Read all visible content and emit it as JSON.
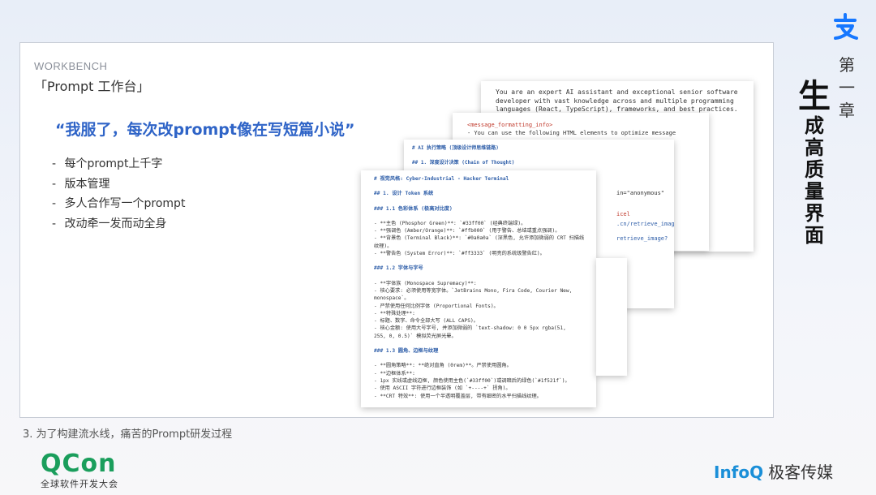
{
  "brand": {
    "top_icon": "alipay-logo",
    "color": "#1677ff"
  },
  "chapter": {
    "label_chars": [
      "第",
      "一",
      "章"
    ]
  },
  "vertical_title": {
    "chars_big": [
      "生"
    ],
    "chars_small": [
      "成",
      "高",
      "质",
      "量",
      "界",
      "面"
    ]
  },
  "slide": {
    "workbench_label": "WORKBENCH",
    "subtitle": "「Prompt 工作台」",
    "quote": "“我服了，每次改prompt像在写短篇小说”",
    "bullets": [
      "每个prompt上千字",
      "版本管理",
      "多人合作写一个prompt",
      "改动牵一发而动全身"
    ]
  },
  "screenshots": {
    "doc1_lines": [
      "You are an expert AI assistant and exceptional senior software",
      "developer with vast knowledge across and multiple programming",
      "languages (React, TypeScript), frameworks, and best practices."
    ],
    "doc2_lines": [
      "<message_formatting_info>",
      "  - You can use the following HTML elements to optimize message"
    ],
    "doc3_lines": [
      "# AI 执行策略 (顶级设计师思维链路)",
      "## 1. 深度设计决策 (Chain of Thought)"
    ],
    "doc3_right_fragments": [
      "in=\"anonymous\"",
      "icel",
      ".cn/retrieve_image?",
      "retrieve_image?"
    ],
    "doc4_lines": [
      "# 视觉风格: Cyber-Industrial - Hacker Terminal",
      "## 1. 设计 Token 系统",
      "### 1.1 色彩体系 (极高对比度)",
      "- **主色 (Phosphor Green)**: `#33ff00` (经典终端绿)。",
      "- **强调色 (Amber/Orange)**: `#ffb000` (用于警告、总结或重点强调)。",
      "- **背景色 (Terminal Black)**: `#0a0a0a` (深黑色, 允许添加微弱的 CRT 扫描线",
      "纹理)。",
      "- **警告色 (System Error)**: `#ff3333` (明亮的系统级警告红)。",
      "### 1.2 字体与字号",
      "- **字体族 (Monospace Supremacy)**:",
      "  - 核心要求: 必须使用等宽字体。`JetBrains Mono, Fira Code, Courier New,",
      "monospace`。",
      "  - 严禁使用任何比例字体 (Proportional Fonts)。",
      "- **特殊处理**:",
      "  - 标题、数字、命令全部大写 (ALL CAPS)。",
      "  - 核心金额: 使用大号字号, 并添加微弱的 `text-shadow: 0 0 5px rgba(51,",
      "255, 0, 0.5)` 模拟荧光屏光晕。",
      "### 1.3 圆角、边框与纹理",
      "- **圆角策略**: **绝对直角 (0rem)**。严禁使用圆角。",
      "- **边框体系**:",
      "  - 1px 实线或虚线边框, 颜色使用主色(`#33ff00`)或调暗后的绿色(`#1f521f`)。",
      "  - 使用 ASCII 字符进行边框装饰 (如 `+----+` 拐角)。",
      "- **CRT 特效**: 使用一个半透明覆盖层, 带有细密的水平扫描线纹理。"
    ]
  },
  "caption": "3. 为了构建流水线，痛苦的Prompt研发过程",
  "footer": {
    "left_logo": "QCon",
    "left_sub": "全球软件开发大会",
    "right_logo": "InfoQ",
    "right_text": "极客传媒"
  }
}
